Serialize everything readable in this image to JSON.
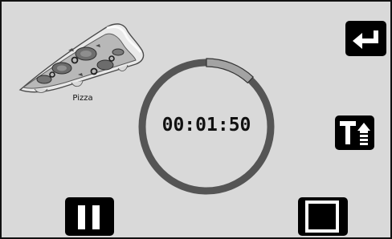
{
  "recipe": {
    "image_name": "pizza-slice-image",
    "label": "Pizza"
  },
  "timer": {
    "time": "00:01:50",
    "progress_fraction": 0.12,
    "ring_color": "#555555",
    "progress_color": "#a3a3a3"
  },
  "buttons": {
    "back_icon": "return-arrow-icon",
    "text_size_icon": "text-size-up-icon",
    "pause_icon": "pause-icon",
    "stop_icon": "stop-icon"
  },
  "colors": {
    "background": "#d9d9d9",
    "button": "#000000",
    "icon": "#ffffff"
  }
}
